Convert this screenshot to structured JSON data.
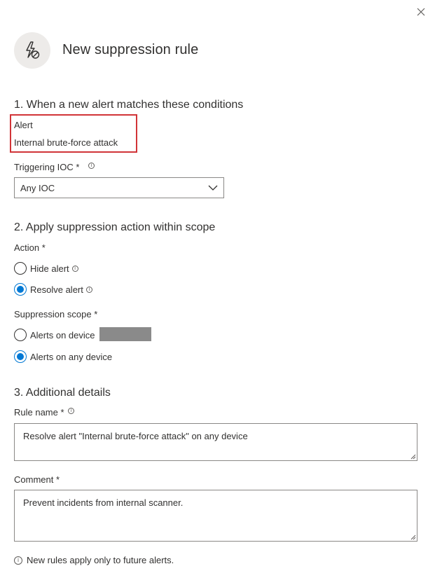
{
  "panel": {
    "title": "New suppression rule",
    "header_icon": "lightning-bolt-prohibited-icon",
    "close_icon": "close-icon"
  },
  "section1": {
    "title": "1. When a new alert matches these conditions",
    "alert_label": "Alert",
    "alert_value": "Internal brute-force attack",
    "triggering_ioc_label": "Triggering IOC",
    "triggering_ioc_required": "*",
    "triggering_ioc_value": "Any IOC"
  },
  "section2": {
    "title": "2. Apply suppression action within scope",
    "action_label": "Action",
    "action_required": "*",
    "action_options": [
      {
        "label": "Hide alert",
        "checked": false
      },
      {
        "label": "Resolve alert",
        "checked": true
      }
    ],
    "scope_label": "Suppression scope",
    "scope_required": "*",
    "scope_options": [
      {
        "label": "Alerts on device",
        "checked": false
      },
      {
        "label": "Alerts on any device",
        "checked": true
      }
    ]
  },
  "section3": {
    "title": "3. Additional details",
    "rule_name_label": "Rule name",
    "rule_name_required": "*",
    "rule_name_value": "Resolve alert \"Internal brute-force attack\" on any device",
    "comment_label": "Comment",
    "comment_required": "*",
    "comment_value": "Prevent incidents from internal scanner."
  },
  "footnote": "New rules apply only to future alerts.",
  "colors": {
    "accent": "#0078d4",
    "highlight_border": "#d13438",
    "redaction": "#8a8a8a"
  }
}
